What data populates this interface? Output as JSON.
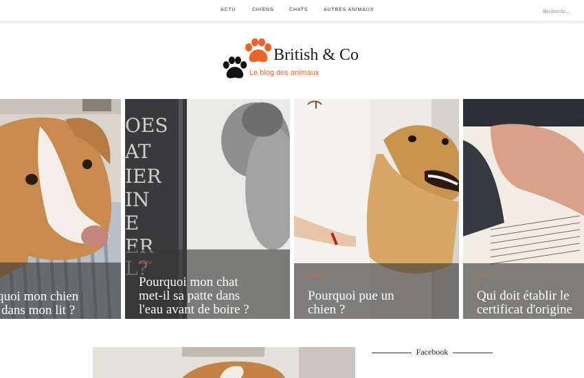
{
  "nav": {
    "items": [
      "ACTU",
      "CHIENS",
      "CHATS",
      "AUTRES ANIMAUX"
    ],
    "search_placeholder": "Recherche..."
  },
  "logo": {
    "title": "British & Co",
    "subtitle": "Le blog des animaux",
    "icons": [
      "paw-orange-icon",
      "paw-black-icon"
    ]
  },
  "carousel": {
    "cards": [
      {
        "category": "",
        "title_lines": [
          "quoi mon chien",
          "dans mon lit ?"
        ],
        "image": "puppy-on-bed-photo"
      },
      {
        "category": "ACTU",
        "title_lines": [
          "Pourquoi mon chat",
          "met-il sa patte dans",
          "l'eau avant de boire ?"
        ],
        "image": "cat-and-book-photo"
      },
      {
        "category": "CHIENS",
        "title_lines": [
          "Pourquoi pue un",
          "chien ?"
        ],
        "image": "golden-retriever-photo"
      },
      {
        "category": "ACTU",
        "title_lines": [
          "Qui doit établir le",
          "certificat d'origine"
        ],
        "image": "certificate-writing-photo"
      }
    ]
  },
  "sidebar": {
    "widget_title": "Facebook"
  },
  "colors": {
    "accent": "#e8642c",
    "overlay": "#373737",
    "text": "#222222"
  }
}
